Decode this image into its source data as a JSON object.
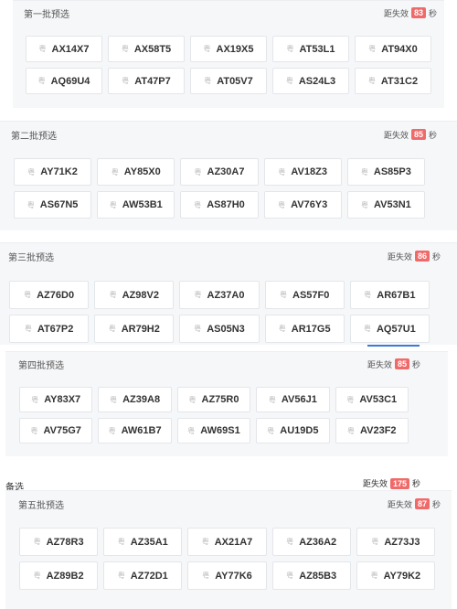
{
  "sections": [
    {
      "title": "第一批预选",
      "timer_label": "距失效",
      "timer_value": "83",
      "timer_unit": "秒",
      "plates": [
        {
          "prefix": "粤",
          "code": "AX14X7"
        },
        {
          "prefix": "粤",
          "code": "AX58T5"
        },
        {
          "prefix": "粤",
          "code": "AX19X5"
        },
        {
          "prefix": "粤",
          "code": "AT53L1"
        },
        {
          "prefix": "粤",
          "code": "AT94X0"
        },
        {
          "prefix": "粤",
          "code": "AQ69U4"
        },
        {
          "prefix": "粤",
          "code": "AT47P7"
        },
        {
          "prefix": "粤",
          "code": "AT05V7"
        },
        {
          "prefix": "粤",
          "code": "AS24L3"
        },
        {
          "prefix": "粤",
          "code": "AT31C2"
        }
      ]
    },
    {
      "title": "第二批预选",
      "timer_label": "距失效",
      "timer_value": "85",
      "timer_unit": "秒",
      "plates": [
        {
          "prefix": "粤",
          "code": "AY71K2"
        },
        {
          "prefix": "粤",
          "code": "AY85X0"
        },
        {
          "prefix": "粤",
          "code": "AZ30A7"
        },
        {
          "prefix": "粤",
          "code": "AV18Z3"
        },
        {
          "prefix": "粤",
          "code": "AS85P3"
        },
        {
          "prefix": "粤",
          "code": "AS67N5"
        },
        {
          "prefix": "粤",
          "code": "AW53B1"
        },
        {
          "prefix": "粤",
          "code": "AS87H0"
        },
        {
          "prefix": "粤",
          "code": "AV76Y3"
        },
        {
          "prefix": "粤",
          "code": "AV53N1"
        }
      ]
    },
    {
      "title": "第三批预选",
      "timer_label": "距失效",
      "timer_value": "86",
      "timer_unit": "秒",
      "plates": [
        {
          "prefix": "粤",
          "code": "AZ76D0"
        },
        {
          "prefix": "粤",
          "code": "AZ98V2"
        },
        {
          "prefix": "粤",
          "code": "AZ37A0"
        },
        {
          "prefix": "粤",
          "code": "AS57F0"
        },
        {
          "prefix": "粤",
          "code": "AR67B1"
        },
        {
          "prefix": "粤",
          "code": "AT67P2"
        },
        {
          "prefix": "粤",
          "code": "AR79H2"
        },
        {
          "prefix": "粤",
          "code": "AS05N3"
        },
        {
          "prefix": "粤",
          "code": "AR17G5"
        },
        {
          "prefix": "粤",
          "code": "AQ57U1"
        }
      ]
    },
    {
      "title": "第四批预选",
      "timer_label": "距失效",
      "timer_value": "85",
      "timer_unit": "秒",
      "plates": [
        {
          "prefix": "粤",
          "code": "AY83X7"
        },
        {
          "prefix": "粤",
          "code": "AZ39A8"
        },
        {
          "prefix": "粤",
          "code": "AZ75R0"
        },
        {
          "prefix": "粤",
          "code": "AV56J1"
        },
        {
          "prefix": "粤",
          "code": "AV53C1"
        },
        {
          "prefix": "粤",
          "code": "AV75G7"
        },
        {
          "prefix": "粤",
          "code": "AW61B7"
        },
        {
          "prefix": "粤",
          "code": "AW69S1"
        },
        {
          "prefix": "粤",
          "code": "AU19D5"
        },
        {
          "prefix": "粤",
          "code": "AV23F2"
        }
      ]
    },
    {
      "title": "第五批预选",
      "timer_label": "距失效",
      "timer_value": "87",
      "timer_unit": "秒",
      "plates": [
        {
          "prefix": "粤",
          "code": "AZ78R3"
        },
        {
          "prefix": "粤",
          "code": "AZ35A1"
        },
        {
          "prefix": "粤",
          "code": "AX21A7"
        },
        {
          "prefix": "粤",
          "code": "AZ36A2"
        },
        {
          "prefix": "粤",
          "code": "AZ73J3"
        },
        {
          "prefix": "粤",
          "code": "AZ89B2"
        },
        {
          "prefix": "粤",
          "code": "AZ72D1"
        },
        {
          "prefix": "粤",
          "code": "AY77K6"
        },
        {
          "prefix": "粤",
          "code": "AZ85B3"
        },
        {
          "prefix": "粤",
          "code": "AY79K2"
        }
      ]
    }
  ],
  "backdrop": {
    "label": "备选",
    "timer_label": "距失效",
    "timer_value": "175",
    "timer_unit": "秒"
  },
  "colors": {
    "timer_badge": "#f06a6a",
    "panel_bg": "#f6f7f9",
    "selected_underline": "#3a7bd5"
  }
}
